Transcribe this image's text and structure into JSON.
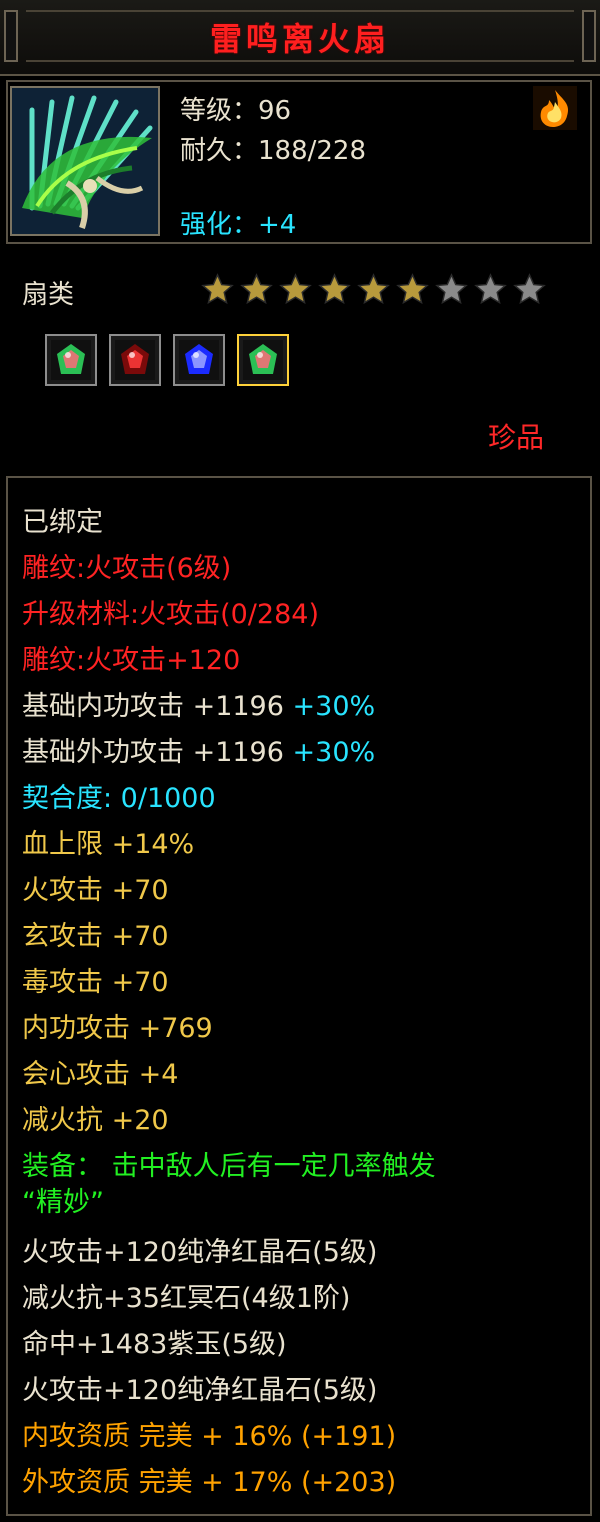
{
  "item": {
    "name": "雷鸣离火扇",
    "level_text": "等级：96",
    "durability_text": "耐久：188/228",
    "enhance_text": "强化：+4",
    "category": "扇类",
    "rarity": "珍品",
    "stars_total": 9,
    "stars_filled": 6,
    "icon": "feather-fan-icon",
    "element_icon": "fire-element-icon"
  },
  "gems": [
    {
      "name": "pure-red-crystal-gem",
      "selected": false
    },
    {
      "name": "red-ming-stone-gem",
      "selected": false
    },
    {
      "name": "purple-jade-gem",
      "selected": false
    },
    {
      "name": "pure-red-crystal-gem",
      "selected": true
    }
  ],
  "attributes": {
    "bound": "已绑定",
    "engrave_1": "雕纹:火攻击(6级)",
    "upgrade_material": "升级材料:火攻击(0/284)",
    "engrave_2": "雕纹:火攻击+120",
    "base_inner": {
      "label": "基础内功攻击  +1196",
      "pct": "+30%"
    },
    "base_outer": {
      "label": "基础外功攻击  +1196",
      "pct": "+30%"
    },
    "affinity": "契合度:  0/1000",
    "hp_cap": "血上限  +14%",
    "fire_atk": "火攻击  +70",
    "xuan_atk": "玄攻击  +70",
    "poison_atk": "毒攻击  +70",
    "inner_atk": "内功攻击  +769",
    "crit_atk": "会心攻击  +4",
    "fire_res_down": "减火抗  +20",
    "equip_effect_1": "装备：  击中敌人后有一定几率触发",
    "equip_effect_2": "“精妙”",
    "gem_1": "火攻击+120纯净红晶石(5级)",
    "gem_2": "减火抗+35红冥石(4级1阶)",
    "gem_3": "命中+1483紫玉(5级)",
    "gem_4": "火攻击+120纯净红晶石(5级)",
    "inner_quality": "内攻资质  完美  +  16%  (+191)",
    "outer_quality": "外攻资质  完美  +  17%  (+203)"
  },
  "colors": {
    "title": "#ff1f1f",
    "white": "#e9e2cf",
    "red": "#ff2323",
    "cyan": "#29e4ff",
    "yellow": "#f0c84a",
    "green": "#22f022",
    "orange": "#ffa200",
    "star_filled": "#b89a3c",
    "star_empty": "#8a8a8a"
  }
}
